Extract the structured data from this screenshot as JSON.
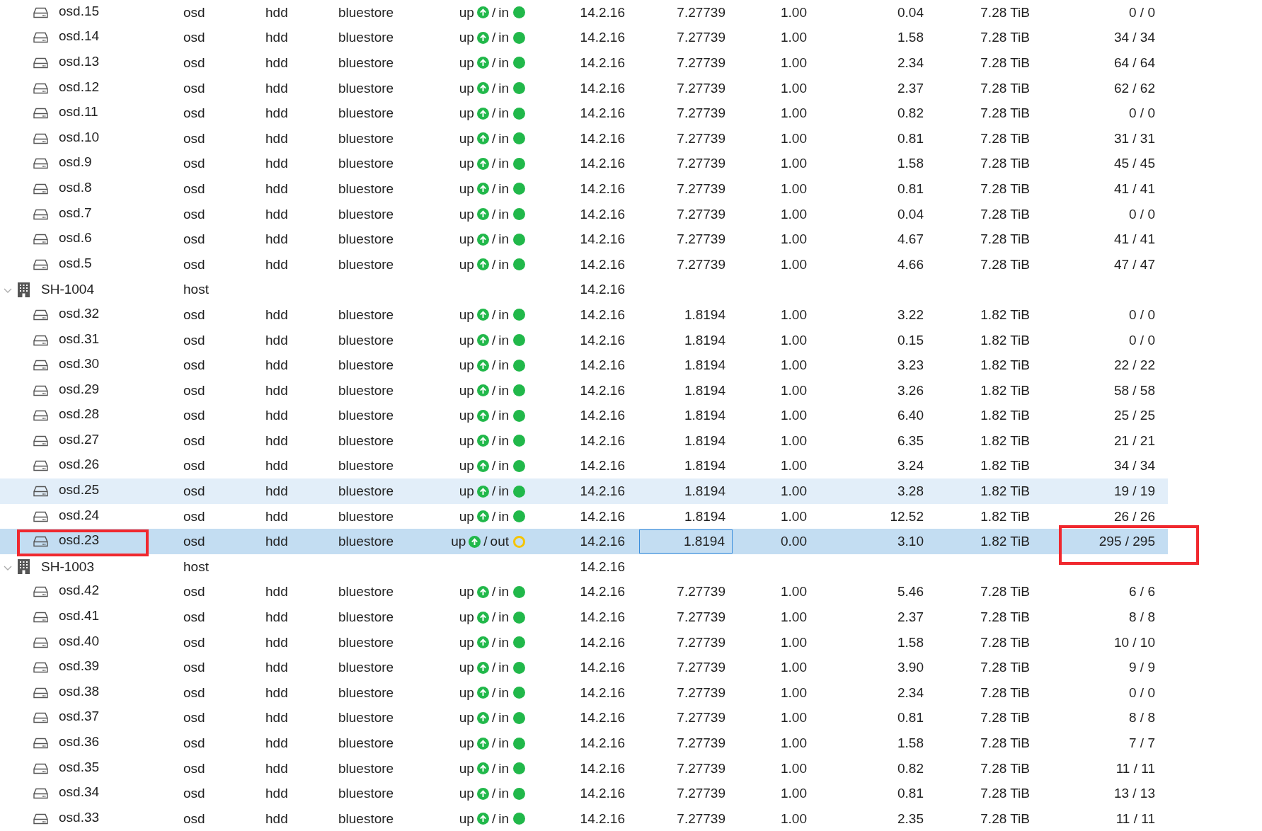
{
  "rows": [
    {
      "kind": "osd",
      "name": "osd.15",
      "type": "osd",
      "class": "hdd",
      "osd_type": "bluestore",
      "up": "up",
      "sep": "/",
      "in_label": "in",
      "in": true,
      "version": "14.2.16",
      "weight": "7.27739",
      "reweight": "1.00",
      "used": "0.04",
      "total": "7.28 TiB",
      "pgs": "0 / 0",
      "selected": false,
      "hover": false
    },
    {
      "kind": "osd",
      "name": "osd.14",
      "type": "osd",
      "class": "hdd",
      "osd_type": "bluestore",
      "up": "up",
      "sep": "/",
      "in_label": "in",
      "in": true,
      "version": "14.2.16",
      "weight": "7.27739",
      "reweight": "1.00",
      "used": "1.58",
      "total": "7.28 TiB",
      "pgs": "34 / 34",
      "selected": false,
      "hover": false
    },
    {
      "kind": "osd",
      "name": "osd.13",
      "type": "osd",
      "class": "hdd",
      "osd_type": "bluestore",
      "up": "up",
      "sep": "/",
      "in_label": "in",
      "in": true,
      "version": "14.2.16",
      "weight": "7.27739",
      "reweight": "1.00",
      "used": "2.34",
      "total": "7.28 TiB",
      "pgs": "64 / 64",
      "selected": false,
      "hover": false
    },
    {
      "kind": "osd",
      "name": "osd.12",
      "type": "osd",
      "class": "hdd",
      "osd_type": "bluestore",
      "up": "up",
      "sep": "/",
      "in_label": "in",
      "in": true,
      "version": "14.2.16",
      "weight": "7.27739",
      "reweight": "1.00",
      "used": "2.37",
      "total": "7.28 TiB",
      "pgs": "62 / 62",
      "selected": false,
      "hover": false
    },
    {
      "kind": "osd",
      "name": "osd.11",
      "type": "osd",
      "class": "hdd",
      "osd_type": "bluestore",
      "up": "up",
      "sep": "/",
      "in_label": "in",
      "in": true,
      "version": "14.2.16",
      "weight": "7.27739",
      "reweight": "1.00",
      "used": "0.82",
      "total": "7.28 TiB",
      "pgs": "0 / 0",
      "selected": false,
      "hover": false
    },
    {
      "kind": "osd",
      "name": "osd.10",
      "type": "osd",
      "class": "hdd",
      "osd_type": "bluestore",
      "up": "up",
      "sep": "/",
      "in_label": "in",
      "in": true,
      "version": "14.2.16",
      "weight": "7.27739",
      "reweight": "1.00",
      "used": "0.81",
      "total": "7.28 TiB",
      "pgs": "31 / 31",
      "selected": false,
      "hover": false
    },
    {
      "kind": "osd",
      "name": "osd.9",
      "type": "osd",
      "class": "hdd",
      "osd_type": "bluestore",
      "up": "up",
      "sep": "/",
      "in_label": "in",
      "in": true,
      "version": "14.2.16",
      "weight": "7.27739",
      "reweight": "1.00",
      "used": "1.58",
      "total": "7.28 TiB",
      "pgs": "45 / 45",
      "selected": false,
      "hover": false
    },
    {
      "kind": "osd",
      "name": "osd.8",
      "type": "osd",
      "class": "hdd",
      "osd_type": "bluestore",
      "up": "up",
      "sep": "/",
      "in_label": "in",
      "in": true,
      "version": "14.2.16",
      "weight": "7.27739",
      "reweight": "1.00",
      "used": "0.81",
      "total": "7.28 TiB",
      "pgs": "41 / 41",
      "selected": false,
      "hover": false
    },
    {
      "kind": "osd",
      "name": "osd.7",
      "type": "osd",
      "class": "hdd",
      "osd_type": "bluestore",
      "up": "up",
      "sep": "/",
      "in_label": "in",
      "in": true,
      "version": "14.2.16",
      "weight": "7.27739",
      "reweight": "1.00",
      "used": "0.04",
      "total": "7.28 TiB",
      "pgs": "0 / 0",
      "selected": false,
      "hover": false
    },
    {
      "kind": "osd",
      "name": "osd.6",
      "type": "osd",
      "class": "hdd",
      "osd_type": "bluestore",
      "up": "up",
      "sep": "/",
      "in_label": "in",
      "in": true,
      "version": "14.2.16",
      "weight": "7.27739",
      "reweight": "1.00",
      "used": "4.67",
      "total": "7.28 TiB",
      "pgs": "41 / 41",
      "selected": false,
      "hover": false
    },
    {
      "kind": "osd",
      "name": "osd.5",
      "type": "osd",
      "class": "hdd",
      "osd_type": "bluestore",
      "up": "up",
      "sep": "/",
      "in_label": "in",
      "in": true,
      "version": "14.2.16",
      "weight": "7.27739",
      "reweight": "1.00",
      "used": "4.66",
      "total": "7.28 TiB",
      "pgs": "47 / 47",
      "selected": false,
      "hover": false
    },
    {
      "kind": "host",
      "name": "SH-1004",
      "type": "host",
      "version": "14.2.16",
      "expanded": true,
      "selected": false,
      "hover": false
    },
    {
      "kind": "osd",
      "name": "osd.32",
      "type": "osd",
      "class": "hdd",
      "osd_type": "bluestore",
      "up": "up",
      "sep": "/",
      "in_label": "in",
      "in": true,
      "version": "14.2.16",
      "weight": "1.8194",
      "reweight": "1.00",
      "used": "3.22",
      "total": "1.82 TiB",
      "pgs": "0 / 0",
      "selected": false,
      "hover": false
    },
    {
      "kind": "osd",
      "name": "osd.31",
      "type": "osd",
      "class": "hdd",
      "osd_type": "bluestore",
      "up": "up",
      "sep": "/",
      "in_label": "in",
      "in": true,
      "version": "14.2.16",
      "weight": "1.8194",
      "reweight": "1.00",
      "used": "0.15",
      "total": "1.82 TiB",
      "pgs": "0 / 0",
      "selected": false,
      "hover": false
    },
    {
      "kind": "osd",
      "name": "osd.30",
      "type": "osd",
      "class": "hdd",
      "osd_type": "bluestore",
      "up": "up",
      "sep": "/",
      "in_label": "in",
      "in": true,
      "version": "14.2.16",
      "weight": "1.8194",
      "reweight": "1.00",
      "used": "3.23",
      "total": "1.82 TiB",
      "pgs": "22 / 22",
      "selected": false,
      "hover": false
    },
    {
      "kind": "osd",
      "name": "osd.29",
      "type": "osd",
      "class": "hdd",
      "osd_type": "bluestore",
      "up": "up",
      "sep": "/",
      "in_label": "in",
      "in": true,
      "version": "14.2.16",
      "weight": "1.8194",
      "reweight": "1.00",
      "used": "3.26",
      "total": "1.82 TiB",
      "pgs": "58 / 58",
      "selected": false,
      "hover": false
    },
    {
      "kind": "osd",
      "name": "osd.28",
      "type": "osd",
      "class": "hdd",
      "osd_type": "bluestore",
      "up": "up",
      "sep": "/",
      "in_label": "in",
      "in": true,
      "version": "14.2.16",
      "weight": "1.8194",
      "reweight": "1.00",
      "used": "6.40",
      "total": "1.82 TiB",
      "pgs": "25 / 25",
      "selected": false,
      "hover": false
    },
    {
      "kind": "osd",
      "name": "osd.27",
      "type": "osd",
      "class": "hdd",
      "osd_type": "bluestore",
      "up": "up",
      "sep": "/",
      "in_label": "in",
      "in": true,
      "version": "14.2.16",
      "weight": "1.8194",
      "reweight": "1.00",
      "used": "6.35",
      "total": "1.82 TiB",
      "pgs": "21 / 21",
      "selected": false,
      "hover": false
    },
    {
      "kind": "osd",
      "name": "osd.26",
      "type": "osd",
      "class": "hdd",
      "osd_type": "bluestore",
      "up": "up",
      "sep": "/",
      "in_label": "in",
      "in": true,
      "version": "14.2.16",
      "weight": "1.8194",
      "reweight": "1.00",
      "used": "3.24",
      "total": "1.82 TiB",
      "pgs": "34 / 34",
      "selected": false,
      "hover": false
    },
    {
      "kind": "osd",
      "name": "osd.25",
      "type": "osd",
      "class": "hdd",
      "osd_type": "bluestore",
      "up": "up",
      "sep": "/",
      "in_label": "in",
      "in": true,
      "version": "14.2.16",
      "weight": "1.8194",
      "reweight": "1.00",
      "used": "3.28",
      "total": "1.82 TiB",
      "pgs": "19 / 19",
      "selected": false,
      "hover": true
    },
    {
      "kind": "osd",
      "name": "osd.24",
      "type": "osd",
      "class": "hdd",
      "osd_type": "bluestore",
      "up": "up",
      "sep": "/",
      "in_label": "in",
      "in": true,
      "version": "14.2.16",
      "weight": "1.8194",
      "reweight": "1.00",
      "used": "12.52",
      "total": "1.82 TiB",
      "pgs": "26 / 26",
      "selected": false,
      "hover": false
    },
    {
      "kind": "osd",
      "name": "osd.23",
      "type": "osd",
      "class": "hdd",
      "osd_type": "bluestore",
      "up": "up",
      "sep": "/",
      "in_label": "out",
      "in": false,
      "version": "14.2.16",
      "weight": "1.8194",
      "reweight": "0.00",
      "used": "3.10",
      "total": "1.82 TiB",
      "pgs": "295 / 295",
      "selected": true,
      "hover": false,
      "name_outlined": true,
      "pgs_outlined": true
    },
    {
      "kind": "host",
      "name": "SH-1003",
      "type": "host",
      "version": "14.2.16",
      "expanded": true,
      "selected": false,
      "hover": false
    },
    {
      "kind": "osd",
      "name": "osd.42",
      "type": "osd",
      "class": "hdd",
      "osd_type": "bluestore",
      "up": "up",
      "sep": "/",
      "in_label": "in",
      "in": true,
      "version": "14.2.16",
      "weight": "7.27739",
      "reweight": "1.00",
      "used": "5.46",
      "total": "7.28 TiB",
      "pgs": "6 / 6",
      "selected": false,
      "hover": false
    },
    {
      "kind": "osd",
      "name": "osd.41",
      "type": "osd",
      "class": "hdd",
      "osd_type": "bluestore",
      "up": "up",
      "sep": "/",
      "in_label": "in",
      "in": true,
      "version": "14.2.16",
      "weight": "7.27739",
      "reweight": "1.00",
      "used": "2.37",
      "total": "7.28 TiB",
      "pgs": "8 / 8",
      "selected": false,
      "hover": false
    },
    {
      "kind": "osd",
      "name": "osd.40",
      "type": "osd",
      "class": "hdd",
      "osd_type": "bluestore",
      "up": "up",
      "sep": "/",
      "in_label": "in",
      "in": true,
      "version": "14.2.16",
      "weight": "7.27739",
      "reweight": "1.00",
      "used": "1.58",
      "total": "7.28 TiB",
      "pgs": "10 / 10",
      "selected": false,
      "hover": false
    },
    {
      "kind": "osd",
      "name": "osd.39",
      "type": "osd",
      "class": "hdd",
      "osd_type": "bluestore",
      "up": "up",
      "sep": "/",
      "in_label": "in",
      "in": true,
      "version": "14.2.16",
      "weight": "7.27739",
      "reweight": "1.00",
      "used": "3.90",
      "total": "7.28 TiB",
      "pgs": "9 / 9",
      "selected": false,
      "hover": false
    },
    {
      "kind": "osd",
      "name": "osd.38",
      "type": "osd",
      "class": "hdd",
      "osd_type": "bluestore",
      "up": "up",
      "sep": "/",
      "in_label": "in",
      "in": true,
      "version": "14.2.16",
      "weight": "7.27739",
      "reweight": "1.00",
      "used": "2.34",
      "total": "7.28 TiB",
      "pgs": "0 / 0",
      "selected": false,
      "hover": false
    },
    {
      "kind": "osd",
      "name": "osd.37",
      "type": "osd",
      "class": "hdd",
      "osd_type": "bluestore",
      "up": "up",
      "sep": "/",
      "in_label": "in",
      "in": true,
      "version": "14.2.16",
      "weight": "7.27739",
      "reweight": "1.00",
      "used": "0.81",
      "total": "7.28 TiB",
      "pgs": "8 / 8",
      "selected": false,
      "hover": false
    },
    {
      "kind": "osd",
      "name": "osd.36",
      "type": "osd",
      "class": "hdd",
      "osd_type": "bluestore",
      "up": "up",
      "sep": "/",
      "in_label": "in",
      "in": true,
      "version": "14.2.16",
      "weight": "7.27739",
      "reweight": "1.00",
      "used": "1.58",
      "total": "7.28 TiB",
      "pgs": "7 / 7",
      "selected": false,
      "hover": false
    },
    {
      "kind": "osd",
      "name": "osd.35",
      "type": "osd",
      "class": "hdd",
      "osd_type": "bluestore",
      "up": "up",
      "sep": "/",
      "in_label": "in",
      "in": true,
      "version": "14.2.16",
      "weight": "7.27739",
      "reweight": "1.00",
      "used": "0.82",
      "total": "7.28 TiB",
      "pgs": "11 / 11",
      "selected": false,
      "hover": false
    },
    {
      "kind": "osd",
      "name": "osd.34",
      "type": "osd",
      "class": "hdd",
      "osd_type": "bluestore",
      "up": "up",
      "sep": "/",
      "in_label": "in",
      "in": true,
      "version": "14.2.16",
      "weight": "7.27739",
      "reweight": "1.00",
      "used": "0.81",
      "total": "7.28 TiB",
      "pgs": "13 / 13",
      "selected": false,
      "hover": false
    },
    {
      "kind": "osd",
      "name": "osd.33",
      "type": "osd",
      "class": "hdd",
      "osd_type": "bluestore",
      "up": "up",
      "sep": "/",
      "in_label": "in",
      "in": true,
      "version": "14.2.16",
      "weight": "7.27739",
      "reweight": "1.00",
      "used": "2.35",
      "total": "7.28 TiB",
      "pgs": "11 / 11",
      "selected": false,
      "hover": false
    }
  ]
}
